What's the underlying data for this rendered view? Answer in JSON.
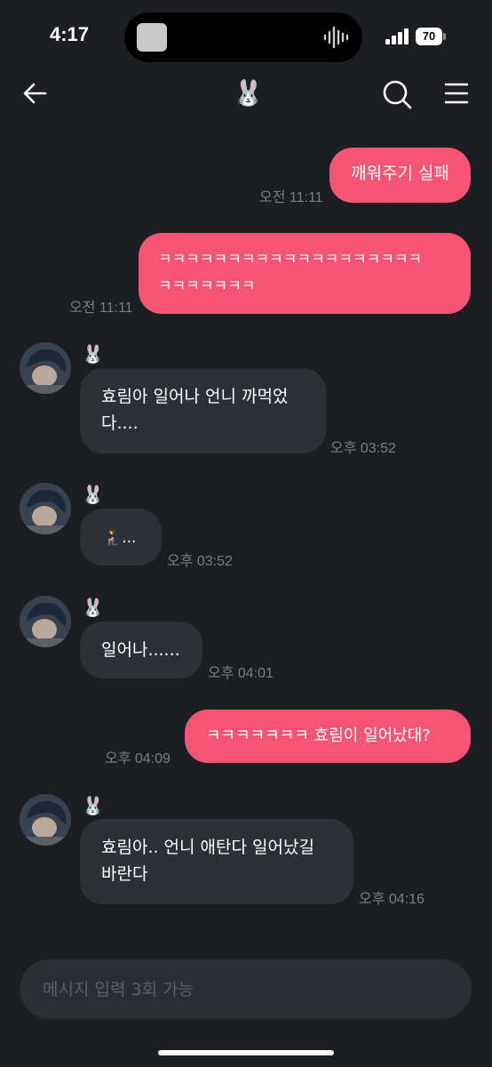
{
  "status_bar": {
    "time": "4:17",
    "battery": "70"
  },
  "header": {
    "title_emoji": "🐰",
    "back_icon": "arrow-left",
    "search_icon": "magnifier",
    "menu_icon": "hamburger"
  },
  "messages": [
    {
      "type": "sent",
      "text": "깨워주기 실패",
      "time": "오전 11:11"
    },
    {
      "type": "sent",
      "lines": [
        "ㅋㅋㅋㅋㅋㅋㅋㅋㅋㅋㅋㅋㅋㅋㅋㅋㅋㅋㅋ",
        "ㅋㅋㅋㅋㅋㅋㅋ"
      ],
      "time": "오전 11:11"
    },
    {
      "type": "received",
      "sender": "🐰",
      "lines": [
        "효림아 일어나 언니 까먹었",
        "다...."
      ],
      "time": "오후 03:52"
    },
    {
      "type": "received",
      "sender": "🐰",
      "text": "🧎‍♀️...",
      "time": "오후 03:52"
    },
    {
      "type": "received",
      "sender": "🐰",
      "text": "일어나......",
      "time": "오후 04:01"
    },
    {
      "type": "sent",
      "text": "ㅋㅋㅋㅋㅋㅋㅋ 효림이 일어났대?",
      "time": "오후 04:09"
    },
    {
      "type": "received",
      "sender": "🐰",
      "lines": [
        "효림아.. 언니 애탄다 일어났길",
        "바란다"
      ],
      "time": "오후 04:16"
    }
  ],
  "input": {
    "placeholder": "메시지 입력 3회 가능"
  },
  "colors": {
    "background": "#1d1e22",
    "sent_bubble": "#f55472",
    "received_bubble": "#2e3037",
    "timestamp": "#7b7d84"
  }
}
